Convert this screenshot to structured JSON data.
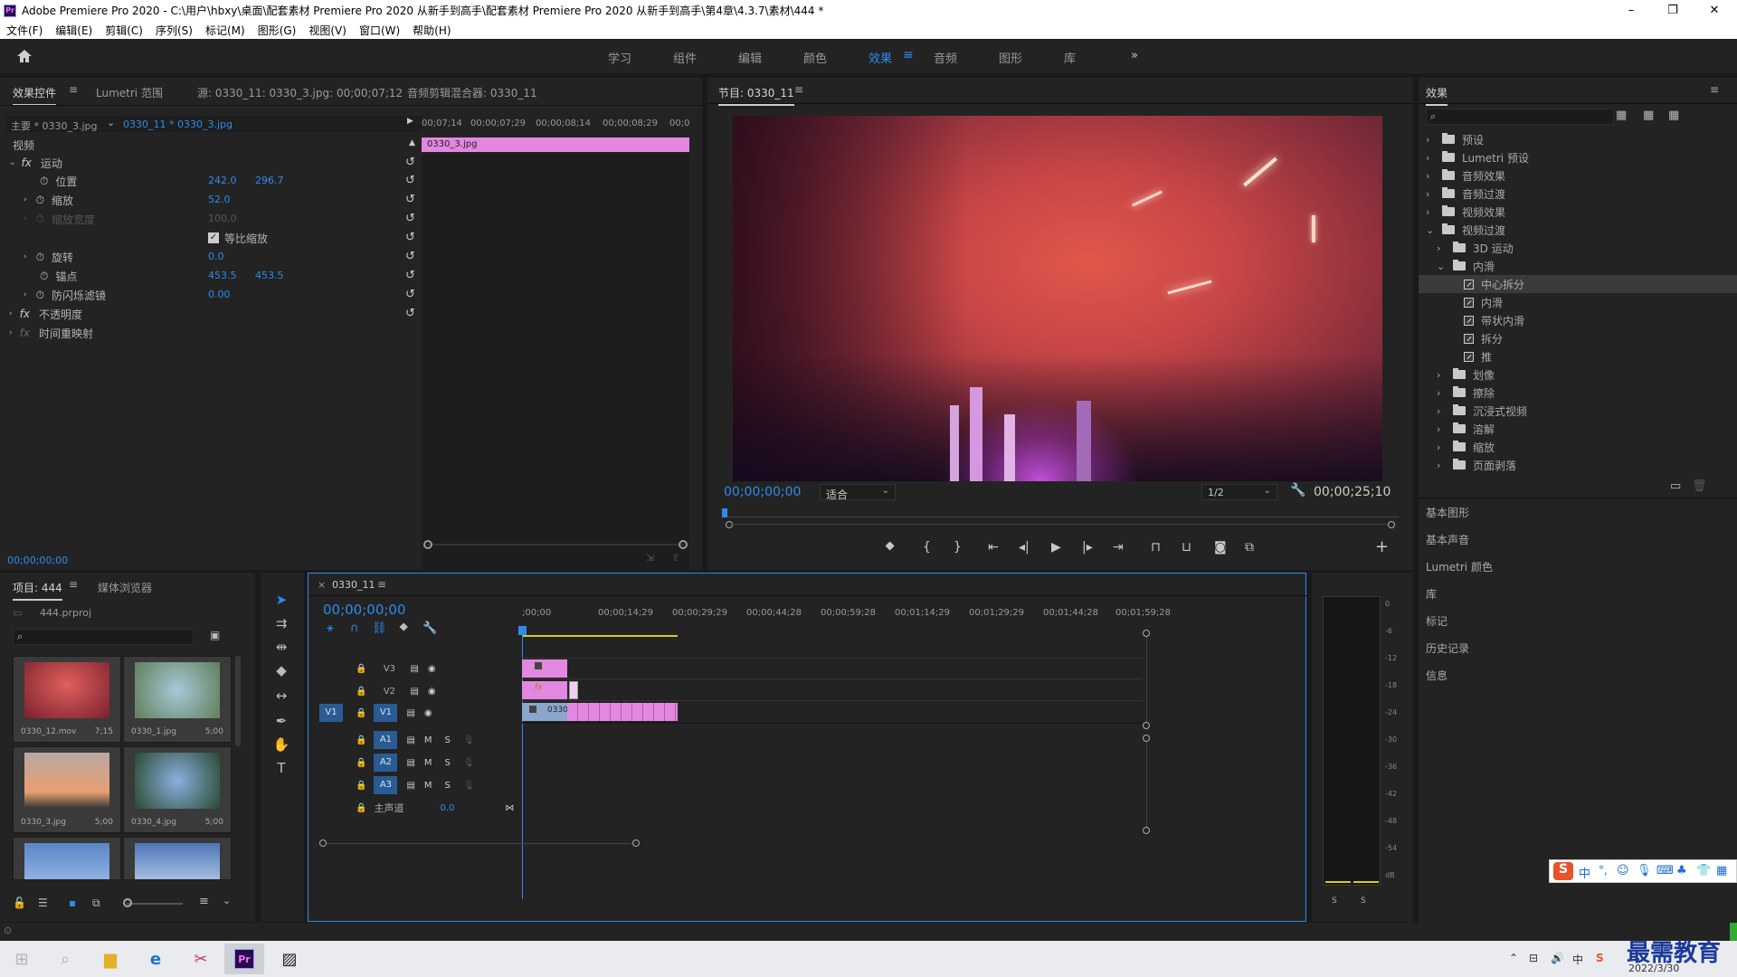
{
  "window": {
    "title": "Adobe Premiere Pro 2020 - C:\\用户\\hbxy\\桌面\\配套素材 Premiere Pro 2020 从新手到高手\\配套素材 Premiere Pro 2020 从新手到高手\\第4章\\4.3.7\\素材\\444 *",
    "logo": "Pr",
    "minimize": "–",
    "maximize": "❐",
    "close": "✕"
  },
  "menu": [
    "文件(F)",
    "编辑(E)",
    "剪辑(C)",
    "序列(S)",
    "标记(M)",
    "图形(G)",
    "视图(V)",
    "窗口(W)",
    "帮助(H)"
  ],
  "workspaces": [
    "学习",
    "组件",
    "编辑",
    "颜色",
    "效果",
    "音频",
    "图形",
    "库"
  ],
  "workspace_active": "效果",
  "workspace_more": "»",
  "effect_controls": {
    "tabs": [
      "效果控件",
      "Lumetri 范围",
      "源: 0330_11: 0330_3.jpg: 00;00;07;12",
      "音频剪辑混合器: 0330_11"
    ],
    "master": "主要 * 0330_3.jpg",
    "clip": "0330_11 * 0330_3.jpg",
    "ruler": [
      "00;07;14",
      "00;00;07;29",
      "00;00;08;14",
      "00;00;08;29",
      "00;0"
    ],
    "clip_bar": "0330_3.jpg",
    "section_video": "视频",
    "motion": "运动",
    "position_label": "位置",
    "position_x": "242.0",
    "position_y": "296.7",
    "scale_label": "缩放",
    "scale": "52.0",
    "scale_width_label": "缩放宽度",
    "scale_width": "100.0",
    "uniform_label": "等比缩放",
    "rotation_label": "旋转",
    "rotation": "0.0",
    "anchor_label": "锚点",
    "anchor_x": "453.5",
    "anchor_y": "453.5",
    "antiflicker_label": "防闪烁滤镜",
    "antiflicker": "0.00",
    "opacity": "不透明度",
    "time_remap": "时间重映射",
    "timecode": "00;00;00;00"
  },
  "program": {
    "tab": "节目: 0330_11",
    "timecode": "00;00;00;00",
    "fit": "适合",
    "quality": "1/2",
    "duration": "00;00;25;10"
  },
  "effects_panel": {
    "title": "效果",
    "items": [
      {
        "label": "预设",
        "level": 0,
        "type": "folder-star",
        "open": false
      },
      {
        "label": "Lumetri 预设",
        "level": 0,
        "type": "folder-star",
        "open": false
      },
      {
        "label": "音频效果",
        "level": 0,
        "type": "folder",
        "open": false
      },
      {
        "label": "音频过渡",
        "level": 0,
        "type": "folder",
        "open": false
      },
      {
        "label": "视频效果",
        "level": 0,
        "type": "folder",
        "open": false
      },
      {
        "label": "视频过渡",
        "level": 0,
        "type": "folder",
        "open": true
      },
      {
        "label": "3D 运动",
        "level": 1,
        "type": "folder",
        "open": false
      },
      {
        "label": "内滑",
        "level": 1,
        "type": "folder",
        "open": true
      },
      {
        "label": "中心拆分",
        "level": 2,
        "type": "fx",
        "selected": true
      },
      {
        "label": "内滑",
        "level": 2,
        "type": "fx"
      },
      {
        "label": "带状内滑",
        "level": 2,
        "type": "fx"
      },
      {
        "label": "拆分",
        "level": 2,
        "type": "fx"
      },
      {
        "label": "推",
        "level": 2,
        "type": "fx"
      },
      {
        "label": "划像",
        "level": 1,
        "type": "folder",
        "open": false
      },
      {
        "label": "擦除",
        "level": 1,
        "type": "folder",
        "open": false
      },
      {
        "label": "沉浸式视频",
        "level": 1,
        "type": "folder",
        "open": false
      },
      {
        "label": "溶解",
        "level": 1,
        "type": "folder",
        "open": false
      },
      {
        "label": "缩放",
        "level": 1,
        "type": "folder",
        "open": false
      },
      {
        "label": "页面剥落",
        "level": 1,
        "type": "folder",
        "open": false
      }
    ],
    "side_panels": [
      "基本图形",
      "基本声音",
      "Lumetri 颜色",
      "库",
      "标记",
      "历史记录",
      "信息"
    ]
  },
  "project": {
    "tabs": [
      "项目: 444",
      "媒体浏览器"
    ],
    "file": "444.prproj",
    "items": [
      {
        "name": "0330_12.mov",
        "duration": "7;15",
        "color": "#c83a3a"
      },
      {
        "name": "0330_1.jpg",
        "duration": "5;00",
        "color": "#7a9a78"
      },
      {
        "name": "0330_3.jpg",
        "duration": "5;00",
        "color": "#d78a58"
      },
      {
        "name": "0330_4.jpg",
        "duration": "5;00",
        "color": "#4a6a90"
      },
      {
        "name": "",
        "duration": "",
        "color": "#5a86c8"
      },
      {
        "name": "",
        "duration": "",
        "color": "#6a8fc2"
      }
    ]
  },
  "timeline": {
    "tab": "0330_11",
    "timecode": "00;00;00;00",
    "ruler": [
      ";00;00",
      "00;00;14;29",
      "00;00;29;29",
      "00;00;44;28",
      "00;00;59;28",
      "00;01;14;29",
      "00;01;29;29",
      "00;01;44;28",
      "00;01;59;28"
    ],
    "video_tracks": [
      "V3",
      "V2",
      "V1"
    ],
    "audio_tracks": [
      "A1",
      "A2",
      "A3"
    ],
    "source_patch_v": "V1",
    "master_label": "主声道",
    "master_value": "0.0",
    "clip_label": "0330",
    "m": "M",
    "s": "S"
  },
  "meter": {
    "scale": [
      "0",
      "-6",
      "-12",
      "-18",
      "-24",
      "-30",
      "-36",
      "-42",
      "-48",
      "-54",
      "dB"
    ],
    "solo": [
      "S",
      "S"
    ]
  },
  "taskbar": {
    "time": "",
    "date": "2022/3/30",
    "watermark": "最需教育",
    "ime": "中"
  }
}
